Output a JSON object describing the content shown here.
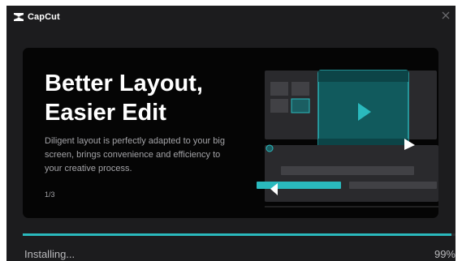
{
  "app": {
    "name": "CapCut",
    "logo_icon": "capcut-logo-icon",
    "close_icon": "close-icon"
  },
  "promo": {
    "headline_line1": "Better Layout,",
    "headline_line2": "Easier Edit",
    "description": "Diligent layout is perfectly adapted to your big screen, brings convenience and efficiency to your creative process.",
    "pager": "1/3",
    "illustration_icon": "editor-layout-illustration-icon"
  },
  "install": {
    "status": "Installing...",
    "percent_label": "99%",
    "progress": 0.99
  },
  "colors": {
    "accent": "#2ab9bd",
    "window_bg": "#1c1c1e",
    "card_bg": "#050505"
  }
}
